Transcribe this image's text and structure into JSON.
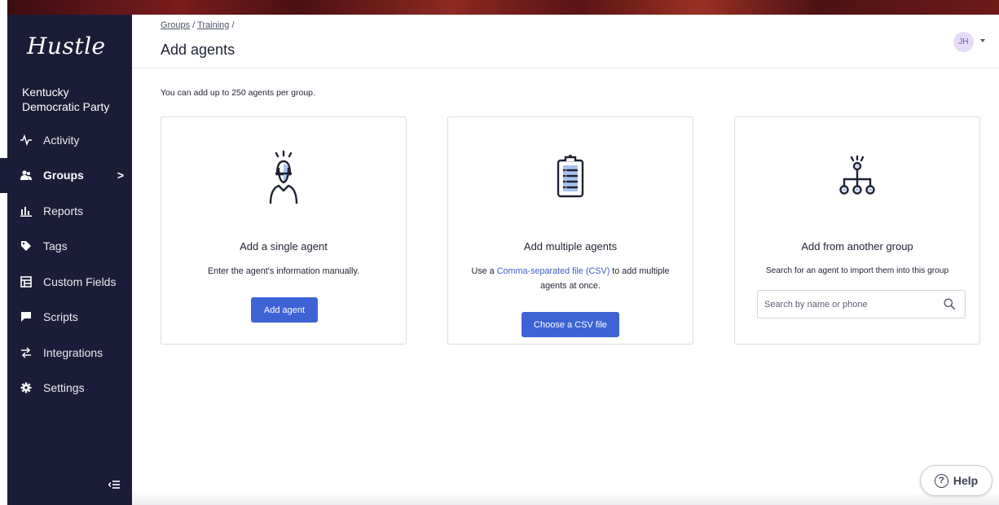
{
  "app": {
    "logo": "Hustle",
    "org_name": "Kentucky Democratic Party"
  },
  "sidebar": {
    "items": [
      {
        "label": "Activity",
        "icon": "activity-icon",
        "active": false
      },
      {
        "label": "Groups",
        "icon": "groups-icon",
        "active": true,
        "chevron": ">"
      },
      {
        "label": "Reports",
        "icon": "reports-icon",
        "active": false
      },
      {
        "label": "Tags",
        "icon": "tag-icon",
        "active": false
      },
      {
        "label": "Custom Fields",
        "icon": "custom-fields-icon",
        "active": false
      },
      {
        "label": "Scripts",
        "icon": "scripts-icon",
        "active": false
      },
      {
        "label": "Integrations",
        "icon": "integrations-icon",
        "active": false
      },
      {
        "label": "Settings",
        "icon": "gear-icon",
        "active": false
      }
    ],
    "collapse_icon": "collapse-sidebar-icon"
  },
  "header": {
    "breadcrumb": [
      "Groups",
      "Training"
    ],
    "breadcrumb_sep": "/",
    "title": "Add agents",
    "avatar_initials": "JH"
  },
  "main": {
    "intro": "You can add up to 250 agents per group.",
    "cards": {
      "single": {
        "title": "Add a single agent",
        "desc": "Enter the agent's information manually.",
        "button": "Add agent"
      },
      "multiple": {
        "title": "Add multiple agents",
        "desc_prefix": "Use a ",
        "desc_link": "Comma-separated file (CSV)",
        "desc_suffix": " to add multiple agents at once.",
        "button": "Choose a CSV file"
      },
      "group": {
        "title": "Add from another group",
        "desc": "Search for an agent to import them into this group",
        "search_placeholder": "Search by name or phone"
      }
    }
  },
  "help": {
    "label": "Help"
  },
  "colors": {
    "sidebar": "#1b1d38",
    "primary": "#3e63d4",
    "link": "#3d5fc4",
    "avatar_bg": "#e6dcf7"
  }
}
